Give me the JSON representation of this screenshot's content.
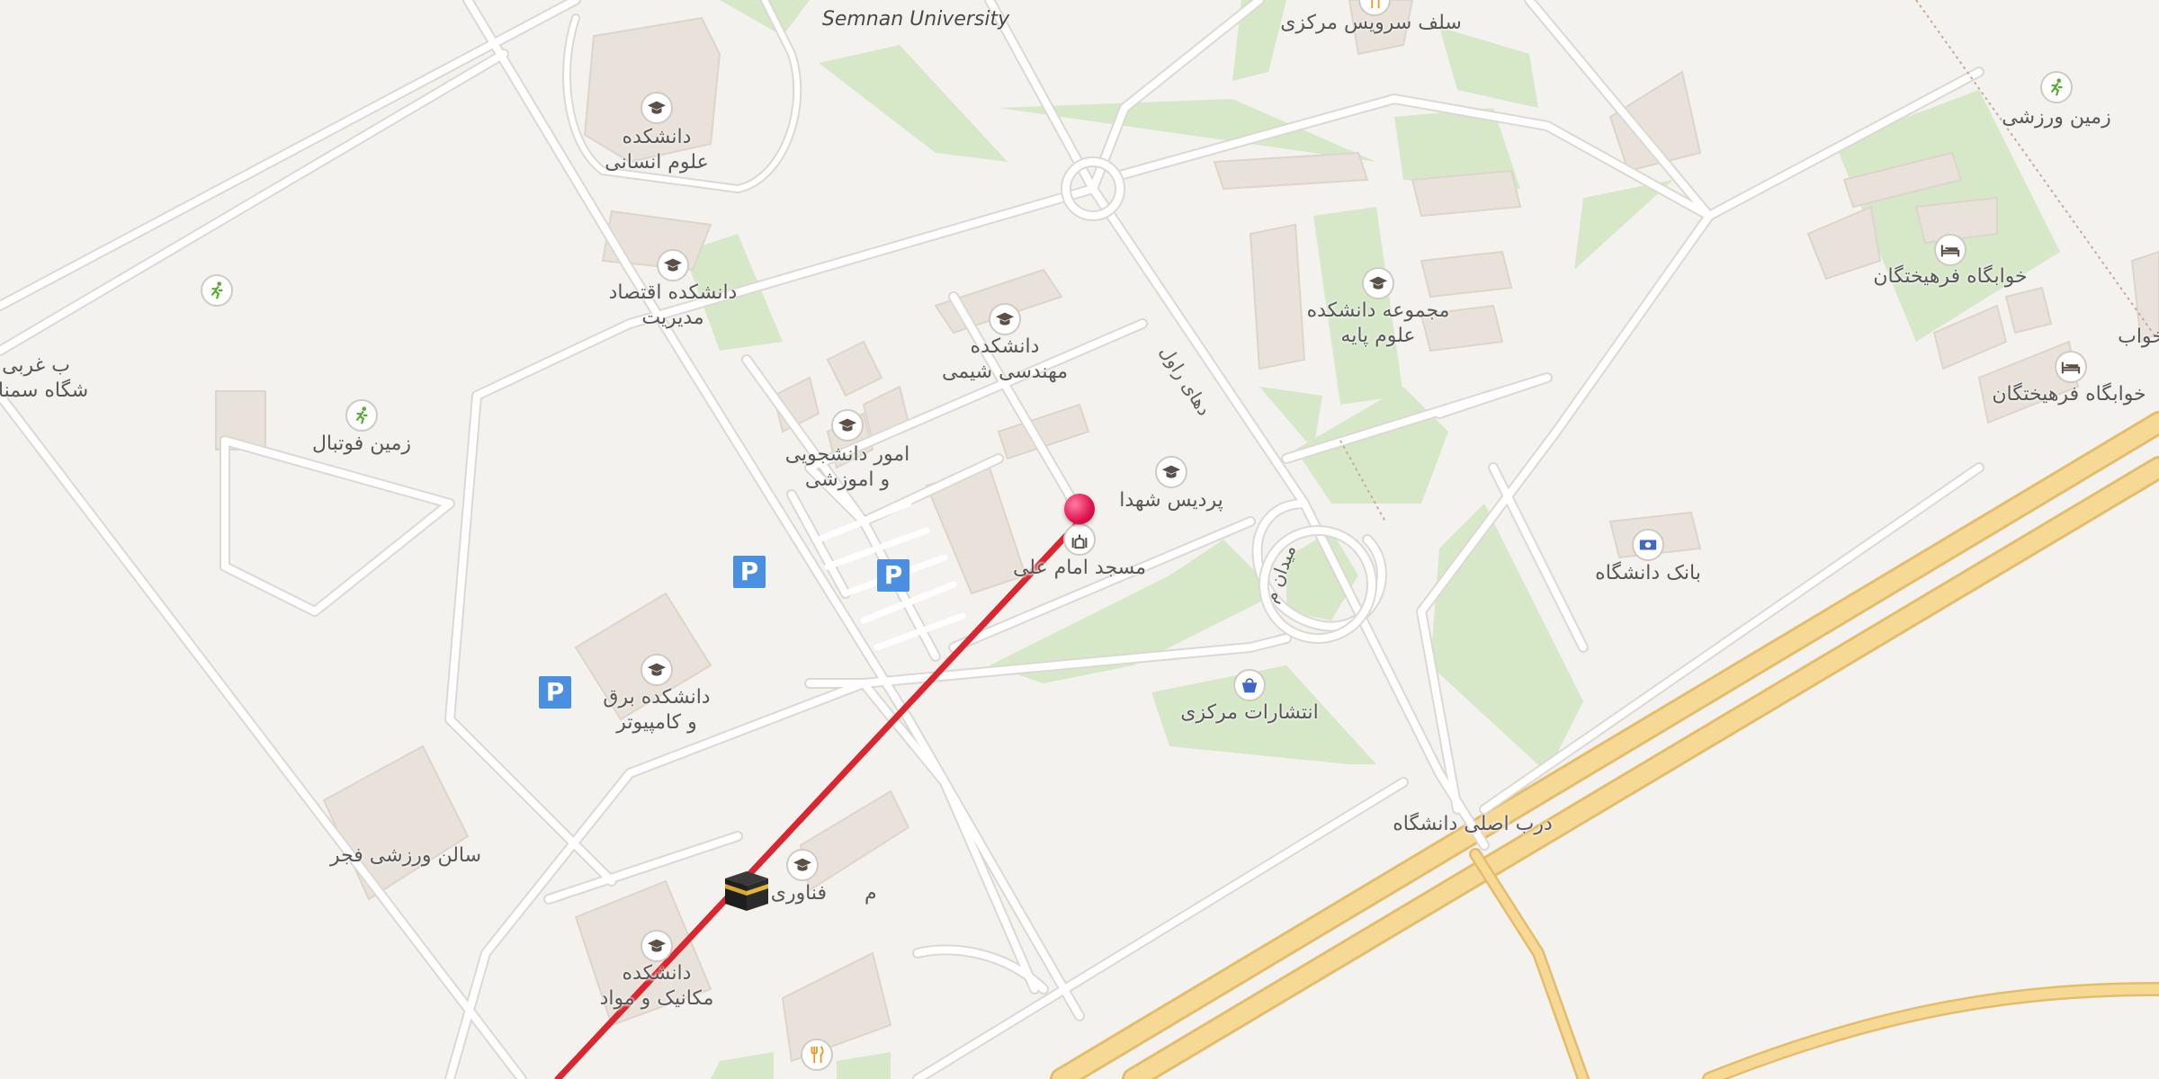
{
  "map": {
    "colors": {
      "background": "#f4f2ef",
      "road": "#ffffff",
      "road_edge": "#dcd8d2",
      "highway": "#f7d996",
      "highway_edge": "#e3bd6c",
      "park": "#d6e8c8",
      "building": "#e9e2da",
      "route_line": "#d9262f",
      "pin": "#e0124d"
    },
    "labels": [
      {
        "id": "semnan-university",
        "text": "Semnan University",
        "lang": "en"
      },
      {
        "id": "central-cafeteria",
        "text": "سلف سرویس مرکزی"
      },
      {
        "id": "faculty-humanities",
        "text": "دانشکده\nعلوم انسانی"
      },
      {
        "id": "faculty-economics",
        "text": "دانشکده اقتصاد\nمدیریت"
      },
      {
        "id": "west-gate",
        "text": "ب غربی\nشگاه سمنان"
      },
      {
        "id": "football-field",
        "text": "زمین فوتبال"
      },
      {
        "id": "faculty-chemical-eng",
        "text": "دانشکده\nمهندسی شیمی"
      },
      {
        "id": "student-affairs",
        "text": "امور دانشجویی\nو اموزشی"
      },
      {
        "id": "shohada-campus",
        "text": "پردیس شهدا"
      },
      {
        "id": "imam-ali-mosque",
        "text": "مسجد امام علی"
      },
      {
        "id": "faculty-basic-sciences",
        "text": "مجموعه دانشکده\nعلوم پایه"
      },
      {
        "id": "sports-field",
        "text": "زمین ورزشی"
      },
      {
        "id": "girls-dorm-1",
        "text": "خوابگاه فرهیختگان"
      },
      {
        "id": "girls-dorm-2",
        "text": "خوابگاه فرهیختگان"
      },
      {
        "id": "girls-dorm-3",
        "text": "خواب"
      },
      {
        "id": "university-bank",
        "text": "بانک دانشگاه"
      },
      {
        "id": "central-publications",
        "text": "انتشارات مرکزی"
      },
      {
        "id": "faculty-electrical",
        "text": "دانشکده برق\nو کامپیوتر"
      },
      {
        "id": "fajr-sports-hall",
        "text": "سالن ورزشی فجر"
      },
      {
        "id": "new-technologies",
        "text": "م      فناوری نوین"
      },
      {
        "id": "faculty-mechanics",
        "text": "دانشکده\nمکانیک و مواد"
      },
      {
        "id": "main-gate",
        "text": "درب اصلی دانشگاه"
      }
    ],
    "road_labels": [
      {
        "id": "road-1",
        "text": "دهای راول"
      },
      {
        "id": "road-2",
        "text": "میدان م"
      }
    ],
    "icons": [
      "university-icon",
      "restaurant-icon",
      "sports-icon",
      "mosque-icon",
      "hotel-icon",
      "bank-icon",
      "shopping-icon",
      "parking-icon",
      "kaaba-icon",
      "location-pin-icon"
    ],
    "parking_text": "P"
  }
}
